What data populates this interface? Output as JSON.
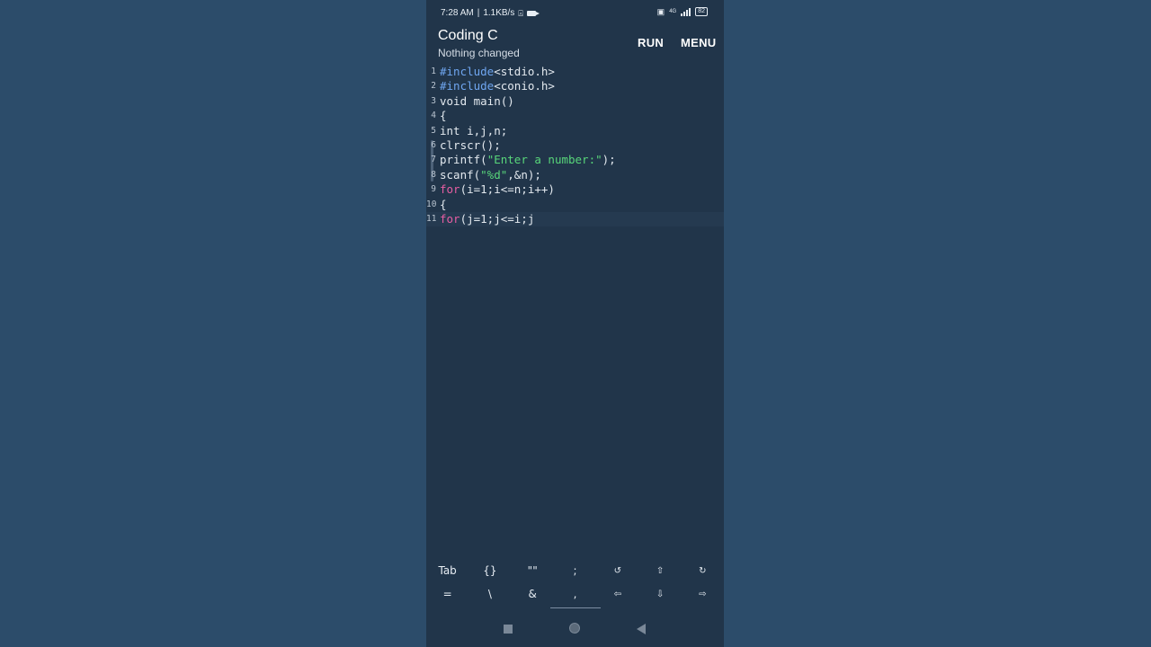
{
  "status": {
    "time": "7:28 AM",
    "separator": "|",
    "speed": "1.1KB/s",
    "battery": "82",
    "network": "4G"
  },
  "app": {
    "title": "Coding C",
    "subtitle": "Nothing changed",
    "run_label": "RUN",
    "menu_label": "MENU"
  },
  "editor": {
    "lines": [
      {
        "n": "1",
        "t": [
          {
            "c": "tk-pre",
            "s": "#include"
          },
          {
            "c": "tk-fn",
            "s": "<stdio.h>"
          }
        ]
      },
      {
        "n": "2",
        "t": [
          {
            "c": "tk-pre",
            "s": "#include"
          },
          {
            "c": "tk-fn",
            "s": "<conio.h>"
          }
        ]
      },
      {
        "n": "3",
        "t": [
          {
            "c": "tk-fn",
            "s": "void main()"
          }
        ]
      },
      {
        "n": "4",
        "t": [
          {
            "c": "tk-fn",
            "s": "{"
          }
        ]
      },
      {
        "n": "5",
        "t": [
          {
            "c": "tk-fn",
            "s": "int i,j,n;"
          }
        ]
      },
      {
        "n": "6",
        "t": [
          {
            "c": "tk-fn",
            "s": "clrscr();"
          }
        ]
      },
      {
        "n": "7",
        "t": [
          {
            "c": "tk-fn",
            "s": "printf("
          },
          {
            "c": "tk-str",
            "s": "\"Enter a number:\""
          },
          {
            "c": "tk-fn",
            "s": ");"
          }
        ]
      },
      {
        "n": "8",
        "t": [
          {
            "c": "tk-fn",
            "s": "scanf("
          },
          {
            "c": "tk-str",
            "s": "\"%d\""
          },
          {
            "c": "tk-fn",
            "s": ",&n);"
          }
        ]
      },
      {
        "n": "9",
        "t": [
          {
            "c": "tk-kw",
            "s": "for"
          },
          {
            "c": "tk-fn",
            "s": "(i=1;i<=n;i++)"
          }
        ]
      },
      {
        "n": "10",
        "t": [
          {
            "c": "tk-fn",
            "s": "{"
          }
        ]
      },
      {
        "n": "11",
        "t": [
          {
            "c": "tk-kw",
            "s": "for"
          },
          {
            "c": "tk-fn",
            "s": "(j=1;j<=i;j"
          }
        ],
        "current": true
      }
    ]
  },
  "keys": {
    "row1": [
      "Tab",
      "{}",
      "\"\"",
      ";",
      "↺",
      "⇧",
      "↻"
    ],
    "row2": [
      "=",
      "\\",
      "&",
      ",",
      "⇦",
      "⇩",
      "⇨"
    ]
  },
  "colors": {
    "background": "#2c4c6a",
    "editor_bg": "#21354a",
    "preprocessor": "#6fa6f0",
    "string": "#58d67a",
    "keyword": "#e75ea3"
  }
}
